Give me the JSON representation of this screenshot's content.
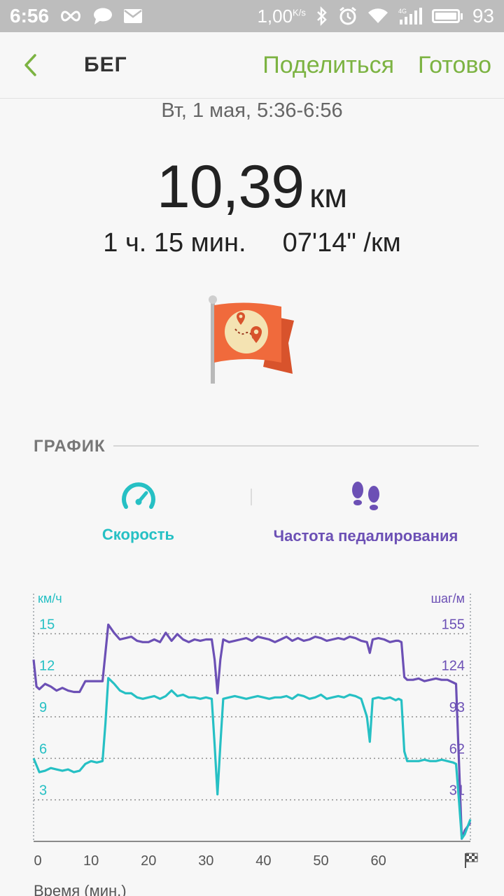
{
  "status_bar": {
    "time": "6:56",
    "net_speed": "1,00",
    "net_unit": "K/s",
    "battery": "93",
    "icons": [
      "infinity-icon",
      "chat-icon",
      "mail-icon",
      "bluetooth-icon",
      "alarm-icon",
      "wifi-icon",
      "signal-4g-icon",
      "battery-icon"
    ]
  },
  "header": {
    "title": "БЕГ",
    "share_label": "Поделиться",
    "done_label": "Готово"
  },
  "summary": {
    "date": "Вт, 1 мая, 5:36-6:56",
    "distance": "10,39",
    "distance_unit": "км",
    "duration": "1 ч. 15 мин.",
    "pace": "07'14\" /км"
  },
  "graph_section": {
    "title": "ГРАФИК",
    "tabs": [
      {
        "label": "Скорость",
        "icon": "speedometer-icon",
        "color": "#26c0c4"
      },
      {
        "label": "Частота педалирования",
        "icon": "footsteps-icon",
        "color": "#6c50b5"
      }
    ]
  },
  "colors": {
    "accent_green": "#7cb342",
    "speed": "#26c0c4",
    "cadence": "#6c50b5",
    "flag": "#f06a3c"
  },
  "chart_data": {
    "type": "line",
    "left_unit": "км/ч",
    "right_unit": "шаг/м",
    "y_left_ticks": [
      3,
      6,
      9,
      12,
      15
    ],
    "y_right_ticks": [
      31,
      62,
      93,
      124,
      155
    ],
    "x_ticks": [
      0,
      10,
      20,
      30,
      40,
      50,
      60
    ],
    "xlabel": "Время (мин.)",
    "ylim": [
      0,
      17.8
    ],
    "y2lim": [
      0,
      183
    ],
    "xlim": [
      0,
      76
    ],
    "grid": true,
    "series": [
      {
        "name": "Скорость",
        "axis": "left",
        "x": [
          0,
          0.5,
          1,
          2,
          3,
          4,
          5,
          6,
          7,
          8,
          9,
          10,
          11,
          12,
          12.5,
          13,
          14,
          15,
          16,
          17,
          18,
          19,
          20,
          21,
          22,
          23,
          24,
          25,
          26,
          27,
          28,
          29,
          30,
          31,
          31.5,
          32,
          32.5,
          33,
          34,
          35,
          36,
          37,
          38,
          39,
          40,
          41,
          42,
          43,
          44,
          45,
          46,
          47,
          48,
          49,
          50,
          51,
          52,
          53,
          54,
          55,
          56,
          57,
          58,
          58.5,
          59,
          60,
          61,
          62,
          63,
          63.5,
          64,
          64.5,
          65,
          66,
          67,
          68,
          69,
          70,
          71,
          72,
          73,
          73.5,
          74,
          74.5,
          75,
          76
        ],
        "values": [
          6.0,
          5.5,
          5.0,
          5.1,
          5.3,
          5.2,
          5.1,
          5.2,
          5.0,
          5.1,
          5.6,
          5.8,
          5.7,
          5.8,
          8.5,
          11.8,
          11.4,
          10.9,
          10.7,
          10.7,
          10.4,
          10.3,
          10.4,
          10.5,
          10.3,
          10.5,
          10.9,
          10.5,
          10.6,
          10.4,
          10.4,
          10.3,
          10.4,
          10.3,
          7.0,
          3.4,
          7.0,
          10.3,
          10.4,
          10.5,
          10.4,
          10.3,
          10.4,
          10.5,
          10.4,
          10.3,
          10.4,
          10.4,
          10.5,
          10.3,
          10.6,
          10.5,
          10.3,
          10.4,
          10.6,
          10.3,
          10.4,
          10.5,
          10.4,
          10.6,
          10.5,
          10.3,
          9.0,
          7.2,
          10.3,
          10.4,
          10.3,
          10.4,
          10.2,
          10.3,
          10.2,
          6.5,
          5.8,
          5.8,
          5.8,
          5.9,
          5.8,
          5.8,
          5.9,
          5.8,
          5.7,
          5.6,
          3.0,
          0.2,
          0.5,
          1.6
        ]
      },
      {
        "name": "Частота педалирования",
        "axis": "right",
        "x": [
          0,
          0.5,
          1,
          2,
          3,
          4,
          5,
          6,
          7,
          8,
          9,
          10,
          11,
          12,
          12.5,
          13,
          14,
          15,
          16,
          17,
          18,
          19,
          20,
          21,
          22,
          23,
          24,
          25,
          26,
          27,
          28,
          29,
          30,
          31,
          31.5,
          32,
          32.5,
          33,
          34,
          35,
          36,
          37,
          38,
          39,
          40,
          41,
          42,
          43,
          44,
          45,
          46,
          47,
          48,
          49,
          50,
          51,
          52,
          53,
          54,
          55,
          56,
          57,
          58,
          58.5,
          59,
          60,
          61,
          62,
          63,
          63.5,
          64,
          64.5,
          65,
          66,
          67,
          68,
          69,
          70,
          71,
          72,
          73,
          73.5,
          74,
          74.5,
          75,
          76
        ],
        "values": [
          135,
          115,
          113,
          117,
          115,
          112,
          114,
          112,
          111,
          111,
          119,
          119,
          119,
          119,
          140,
          161,
          155,
          150,
          151,
          152,
          149,
          148,
          148,
          150,
          148,
          155,
          149,
          154,
          150,
          148,
          150,
          149,
          150,
          150,
          135,
          110,
          135,
          150,
          148,
          149,
          150,
          151,
          149,
          152,
          151,
          150,
          148,
          150,
          152,
          149,
          151,
          149,
          150,
          152,
          151,
          149,
          150,
          151,
          150,
          152,
          151,
          149,
          148,
          140,
          150,
          151,
          150,
          148,
          149,
          149,
          148,
          122,
          120,
          120,
          121,
          119,
          120,
          121,
          120,
          120,
          118,
          117,
          60,
          2,
          8,
          14
        ]
      }
    ]
  }
}
